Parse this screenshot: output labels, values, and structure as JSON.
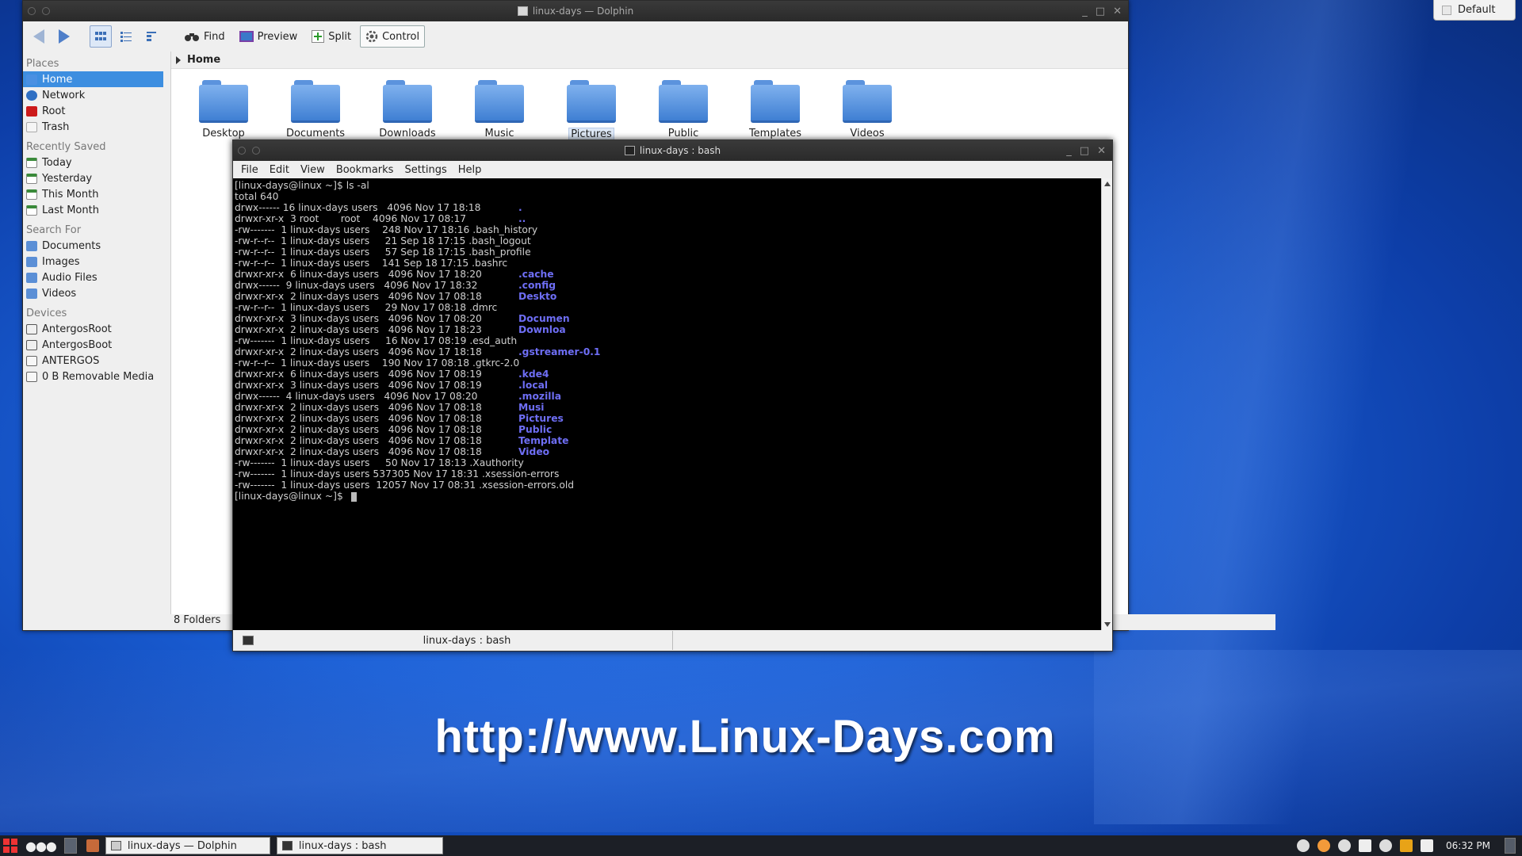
{
  "dolphin": {
    "title": "linux-days — Dolphin",
    "toolbar": {
      "find": "Find",
      "preview": "Preview",
      "split": "Split",
      "control": "Control"
    },
    "sidebar": {
      "places_header": "Places",
      "places": [
        "Home",
        "Network",
        "Root",
        "Trash"
      ],
      "recent_header": "Recently Saved",
      "recent": [
        "Today",
        "Yesterday",
        "This Month",
        "Last Month"
      ],
      "search_header": "Search For",
      "search": [
        "Documents",
        "Images",
        "Audio Files",
        "Videos"
      ],
      "devices_header": "Devices",
      "devices": [
        "AntergosRoot",
        "AntergosBoot",
        "ANTERGOS",
        "0 B Removable Media"
      ]
    },
    "breadcrumb": "Home",
    "folders": [
      "Desktop",
      "Documents",
      "Downloads",
      "Music",
      "Pictures",
      "Public",
      "Templates",
      "Videos"
    ],
    "status": "8 Folders"
  },
  "konsole": {
    "title": "linux-days : bash",
    "menu": [
      "File",
      "Edit",
      "View",
      "Bookmarks",
      "Settings",
      "Help"
    ],
    "tab_label": "linux-days : bash",
    "lines": [
      {
        "t": "[linux-days@linux ~]$ ls -al",
        "f": ""
      },
      {
        "t": "total 640",
        "f": ""
      },
      {
        "t": "drwx------ 16 linux-days users   4096 Nov 17 18:18",
        "f": "."
      },
      {
        "t": "drwxr-xr-x  3 root       root    4096 Nov 17 08:17",
        "f": ".."
      },
      {
        "t": "-rw-------  1 linux-days users    248 Nov 17 18:16 .bash_history",
        "f": ""
      },
      {
        "t": "-rw-r--r--  1 linux-days users     21 Sep 18 17:15 .bash_logout",
        "f": ""
      },
      {
        "t": "-rw-r--r--  1 linux-days users     57 Sep 18 17:15 .bash_profile",
        "f": ""
      },
      {
        "t": "-rw-r--r--  1 linux-days users    141 Sep 18 17:15 .bashrc",
        "f": ""
      },
      {
        "t": "drwxr-xr-x  6 linux-days users   4096 Nov 17 18:20",
        "f": ".cache"
      },
      {
        "t": "drwx------  9 linux-days users   4096 Nov 17 18:32",
        "f": ".config"
      },
      {
        "t": "drwxr-xr-x  2 linux-days users   4096 Nov 17 08:18",
        "f": "Deskto"
      },
      {
        "t": "-rw-r--r--  1 linux-days users     29 Nov 17 08:18 .dmrc",
        "f": ""
      },
      {
        "t": "drwxr-xr-x  3 linux-days users   4096 Nov 17 08:20",
        "f": "Documen"
      },
      {
        "t": "drwxr-xr-x  2 linux-days users   4096 Nov 17 18:23",
        "f": "Downloa"
      },
      {
        "t": "-rw-------  1 linux-days users     16 Nov 17 08:19 .esd_auth",
        "f": ""
      },
      {
        "t": "drwxr-xr-x  2 linux-days users   4096 Nov 17 18:18",
        "f": ".gstreamer-0.1"
      },
      {
        "t": "-rw-r--r--  1 linux-days users    190 Nov 17 08:18 .gtkrc-2.0",
        "f": ""
      },
      {
        "t": "drwxr-xr-x  6 linux-days users   4096 Nov 17 08:19",
        "f": ".kde4"
      },
      {
        "t": "drwxr-xr-x  3 linux-days users   4096 Nov 17 08:19",
        "f": ".local"
      },
      {
        "t": "drwx------  4 linux-days users   4096 Nov 17 08:20",
        "f": ".mozilla"
      },
      {
        "t": "drwxr-xr-x  2 linux-days users   4096 Nov 17 08:18",
        "f": "Musi"
      },
      {
        "t": "drwxr-xr-x  2 linux-days users   4096 Nov 17 08:18",
        "f": "Pictures"
      },
      {
        "t": "drwxr-xr-x  2 linux-days users   4096 Nov 17 08:18",
        "f": "Public"
      },
      {
        "t": "drwxr-xr-x  2 linux-days users   4096 Nov 17 08:18",
        "f": "Template"
      },
      {
        "t": "drwxr-xr-x  2 linux-days users   4096 Nov 17 08:18",
        "f": "Video"
      },
      {
        "t": "-rw-------  1 linux-days users     50 Nov 17 18:13 .Xauthority",
        "f": ""
      },
      {
        "t": "-rw-------  1 linux-days users 537305 Nov 17 18:31 .xsession-errors",
        "f": ""
      },
      {
        "t": "-rw-------  1 linux-days users  12057 Nov 17 08:31 .xsession-errors.old",
        "f": ""
      }
    ],
    "prompt": "[linux-days@linux ~]$"
  },
  "default_button": "Default",
  "watermark": "http://www.Linux-Days.com",
  "taskbar": {
    "tasks": [
      "linux-days — Dolphin",
      "linux-days : bash"
    ],
    "clock": "06:32 PM"
  },
  "colors": {
    "accent": "#3d8ee0",
    "terminal_dir": "#6e6ef5",
    "desktop": "#1a5fd6"
  }
}
